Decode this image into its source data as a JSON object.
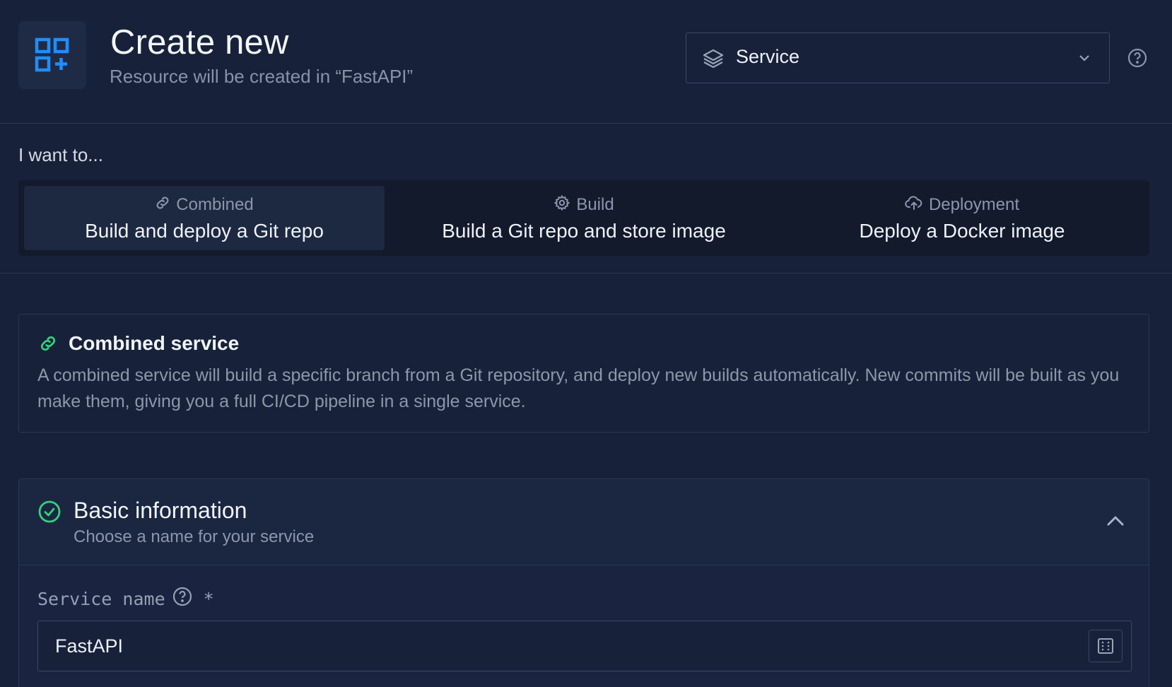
{
  "header": {
    "title": "Create new",
    "subtitle": "Resource will be created in “FastAPI”",
    "type_select": {
      "value": "Service"
    }
  },
  "want": {
    "label": "I want to...",
    "tabs": [
      {
        "kind": "Combined",
        "description": "Build and deploy a Git repo",
        "active": true,
        "icon": "link-icon"
      },
      {
        "kind": "Build",
        "description": "Build a Git repo and store image",
        "active": false,
        "icon": "gear-icon"
      },
      {
        "kind": "Deployment",
        "description": "Deploy a Docker image",
        "active": false,
        "icon": "cloud-upload-icon"
      }
    ]
  },
  "info": {
    "title": "Combined service",
    "text": "A combined service will build a specific branch from a Git repository, and deploy new builds automatically. New commits will be built as you make them, giving you a full CI/CD pipeline in a single service."
  },
  "basic": {
    "title": "Basic information",
    "subtitle": "Choose a name for your service",
    "field_label": "Service name",
    "required_mark": "*",
    "field_value": "FastAPI"
  },
  "colors": {
    "background": "#17213a",
    "accent_blue": "#1e8fff",
    "success_green": "#34d17f",
    "muted_text": "#8d97ab"
  }
}
